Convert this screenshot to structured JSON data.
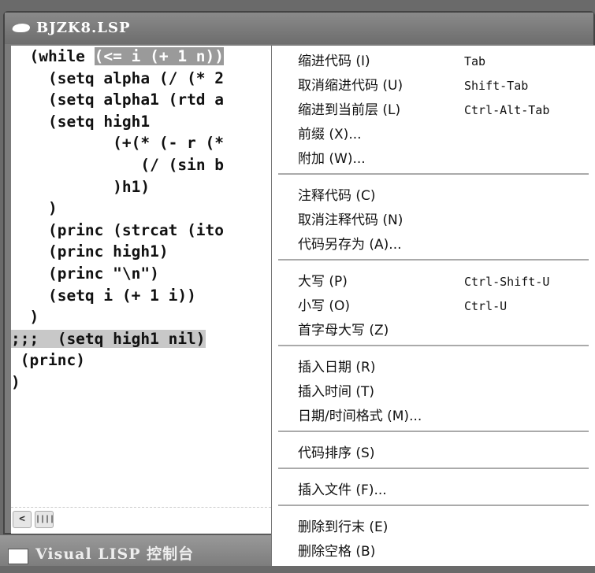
{
  "editor": {
    "title": "BJZK8.LSP",
    "lines": [
      {
        "indent": "  ",
        "text": "(while ",
        "hl": "(<= i (+ 1 n))"
      },
      {
        "indent": "    ",
        "text": "(setq alpha (/ (* 2"
      },
      {
        "indent": "    ",
        "text": "(setq alpha1 (rtd a"
      },
      {
        "indent": "    ",
        "text": "(setq high1"
      },
      {
        "indent": "           ",
        "text": "(+(* (- r (*"
      },
      {
        "indent": "              ",
        "text": "(/ (sin b"
      },
      {
        "indent": "           ",
        "text": ")h1)"
      },
      {
        "indent": "    ",
        "text": ")"
      },
      {
        "indent": "    ",
        "text": "(princ (strcat (ito"
      },
      {
        "indent": "    ",
        "text": "(princ high1)"
      },
      {
        "indent": "    ",
        "text": "(princ \"\\n\")"
      },
      {
        "indent": "    ",
        "text": "(setq i (+ 1 i))"
      },
      {
        "indent": "  ",
        "text": ")"
      },
      {
        "indent": "",
        "text": ";;;  (setq high1 nil)",
        "line_hl": true
      },
      {
        "indent": " ",
        "text": "(princ)"
      },
      {
        "indent": "",
        "text": ")"
      }
    ],
    "scroll_left": "<"
  },
  "console": {
    "title": "Visual LISP 控制台"
  },
  "menu": {
    "groups": [
      [
        {
          "label": "缩进代码 (I)",
          "shortcut": "Tab"
        },
        {
          "label": "取消缩进代码 (U)",
          "shortcut": "Shift-Tab"
        },
        {
          "label": "缩进到当前层 (L)",
          "shortcut": "Ctrl-Alt-Tab"
        },
        {
          "label": "前缀 (X)..."
        },
        {
          "label": "附加 (W)..."
        }
      ],
      [
        {
          "label": "注释代码 (C)"
        },
        {
          "label": "取消注释代码 (N)"
        },
        {
          "label": "代码另存为 (A)..."
        }
      ],
      [
        {
          "label": "大写 (P)",
          "shortcut": "Ctrl-Shift-U"
        },
        {
          "label": "小写 (O)",
          "shortcut": "Ctrl-U"
        },
        {
          "label": "首字母大写 (Z)"
        }
      ],
      [
        {
          "label": "插入日期 (R)"
        },
        {
          "label": "插入时间 (T)"
        },
        {
          "label": "日期/时间格式 (M)..."
        }
      ],
      [
        {
          "label": "代码排序 (S)"
        }
      ],
      [
        {
          "label": "插入文件 (F)..."
        }
      ],
      [
        {
          "label": "删除到行末 (E)"
        },
        {
          "label": "删除空格 (B)"
        }
      ]
    ]
  }
}
